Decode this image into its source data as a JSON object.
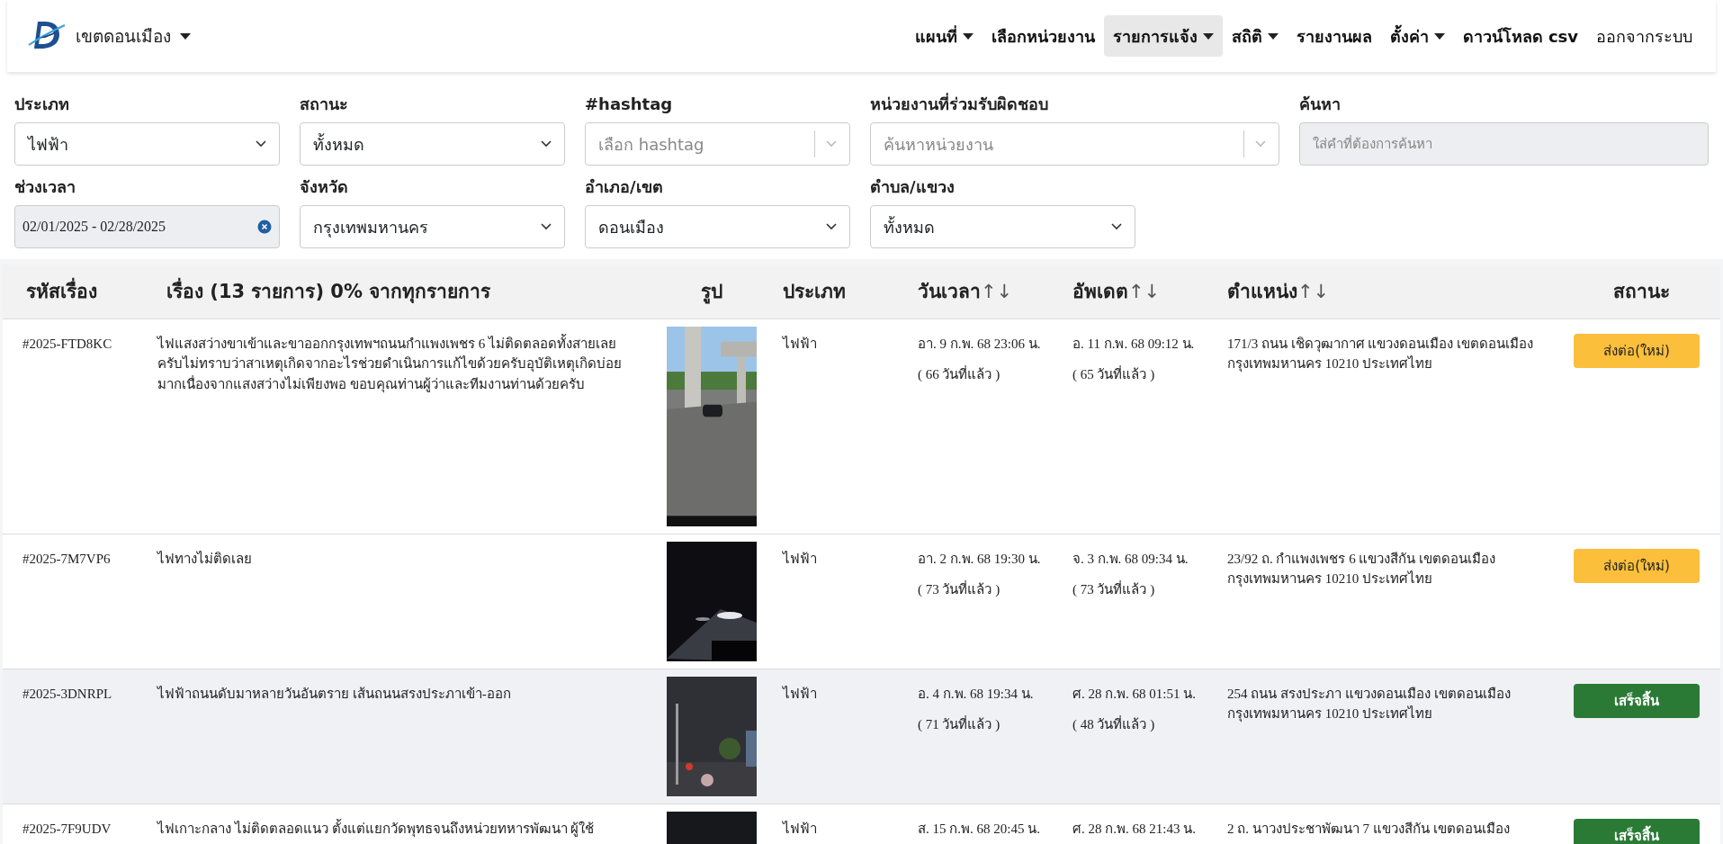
{
  "brand": {
    "label": "เขตดอนเมือง"
  },
  "nav": [
    {
      "label": "แผนที่",
      "dropdown": true,
      "selected": false,
      "kind": "page"
    },
    {
      "label": "เลือกหน่วยงาน",
      "dropdown": false,
      "selected": false,
      "kind": "page"
    },
    {
      "label": "รายการแจ้ง",
      "dropdown": true,
      "selected": true,
      "kind": "page"
    },
    {
      "label": "สถิติ",
      "dropdown": true,
      "selected": false,
      "kind": "page"
    },
    {
      "label": "รายงานผล",
      "dropdown": false,
      "selected": false,
      "kind": "page"
    },
    {
      "label": "ตั้งค่า",
      "dropdown": true,
      "selected": false,
      "kind": "page"
    },
    {
      "label": "ดาวน์โหลด csv",
      "dropdown": false,
      "selected": false,
      "kind": "page"
    },
    {
      "label": "ออกจากระบบ",
      "dropdown": false,
      "selected": false,
      "kind": "logout"
    }
  ],
  "filters": [
    {
      "label": "ประเภท",
      "kind": "select",
      "value": "ไฟฟ้า"
    },
    {
      "label": "สถานะ",
      "kind": "select",
      "value": "ทั้งหมด"
    },
    {
      "label": "#hashtag",
      "kind": "multiselect",
      "placeholder": "เลือก hashtag"
    },
    {
      "label": "หน่วยงานที่ร่วมรับผิดชอบ",
      "kind": "multiselect",
      "placeholder": "ค้นหาหน่วยงาน"
    },
    {
      "label": "ค้นหา",
      "kind": "text",
      "placeholder": "ใส่คำที่ต้องการค้นหา"
    },
    {
      "label": "ช่วงเวลา",
      "kind": "daterange",
      "value": "02/01/2025 - 02/28/2025"
    },
    {
      "label": "จังหวัด",
      "kind": "select",
      "value": "กรุงเทพมหานคร"
    },
    {
      "label": "อำเภอ/เขต",
      "kind": "select",
      "value": "ดอนเมือง"
    },
    {
      "label": "ตำบล/แขวง",
      "kind": "select",
      "value": "ทั้งหมด"
    }
  ],
  "table": {
    "columns": [
      {
        "label": "รหัสเรื่อง"
      },
      {
        "label": "เรื่อง (13 รายการ) 0% จากทุกรายการ"
      },
      {
        "label": "รูป"
      },
      {
        "label": "ประเภท"
      },
      {
        "label": "วันเวลา",
        "sort": "↑↓"
      },
      {
        "label": "อัพเดต",
        "sort": "↑↓"
      },
      {
        "label": "ตำแหน่ง",
        "sort": "↑↓"
      },
      {
        "label": "สถานะ"
      }
    ],
    "rows": [
      {
        "code": "#2025-FTD8KC",
        "title": "ไฟแสงสว่างขาเข้าและขาออกกรุงเทพฯถนนกำแพงเพชร 6 ไม่ติดตลอดทั้งสายเลยครับไม่ทราบว่าสาเหตุเกิดจากอะไรช่วยดำเนินการแก้ไขด้วยครับอุบัติเหตุเกิดบ่อยมากเนื่องจากแสงสว่างไม่เพียงพอ ขอบคุณท่านผู้ว่าและทีมงานท่านด้วยครับ",
        "type": "ไฟฟ้า",
        "date": "อา. 9 ก.พ. 68 23:06 น.",
        "date_ago": "( 66 วันที่แล้ว )",
        "updated": "อ. 11 ก.พ. 68 09:12 น.",
        "updated_ago": "( 65 วันที่แล้ว )",
        "location": "171/3 ถนน เชิดวุฒากาศ แขวงดอนเมือง เขตดอนเมือง กรุงเทพมหานคร 10210 ประเทศไทย",
        "status": {
          "label": "ส่งต่อ(ใหม่)",
          "kind": "forwarded"
        },
        "highlighted": false
      },
      {
        "code": "#2025-7M7VP6",
        "title": "ไฟทางไม่ติดเลย",
        "type": "ไฟฟ้า",
        "date": "อา. 2 ก.พ. 68 19:30 น.",
        "date_ago": "( 73 วันที่แล้ว )",
        "updated": "จ. 3 ก.พ. 68 09:34 น.",
        "updated_ago": "( 73 วันที่แล้ว )",
        "location": "23/92 ถ. กำแพงเพชร 6 แขวงสีกัน เขตดอนเมือง กรุงเทพมหานคร 10210 ประเทศไทย",
        "status": {
          "label": "ส่งต่อ(ใหม่)",
          "kind": "forwarded"
        },
        "highlighted": false
      },
      {
        "code": "#2025-3DNRPL",
        "title": "ไฟฟ้าถนนดับมาหลายวันอันตราย เส้นถนนสรงประภาเข้า-ออก",
        "type": "ไฟฟ้า",
        "date": "อ. 4 ก.พ. 68 19:34 น.",
        "date_ago": "( 71 วันที่แล้ว )",
        "updated": "ศ. 28 ก.พ. 68 01:51 น.",
        "updated_ago": "( 48 วันที่แล้ว )",
        "location": "254 ถนน สรงประภา แขวงดอนเมือง เขตดอนเมือง กรุงเทพมหานคร 10210 ประเทศไทย",
        "status": {
          "label": "เสร็จสิ้น",
          "kind": "done"
        },
        "highlighted": true
      },
      {
        "code": "#2025-7F9UDV",
        "title": "ไฟเกาะกลาง ไม่ติดตลอดแนว ตั้งแต่แยกวัดพุทธจนถึงหน่วยทหารพัฒนา ผู้ใช้",
        "type": "ไฟฟ้า",
        "date": "ส. 15 ก.พ. 68 20:45 น.",
        "updated": "ศ. 28 ก.พ. 68 21:43 น.",
        "location": "2 ถ. นาวงประชาพัฒนา 7 แขวงสีกัน เขตดอนเมือง",
        "status": {
          "label": "เสร็จสิ้น",
          "kind": "done"
        },
        "highlighted": false
      }
    ]
  }
}
